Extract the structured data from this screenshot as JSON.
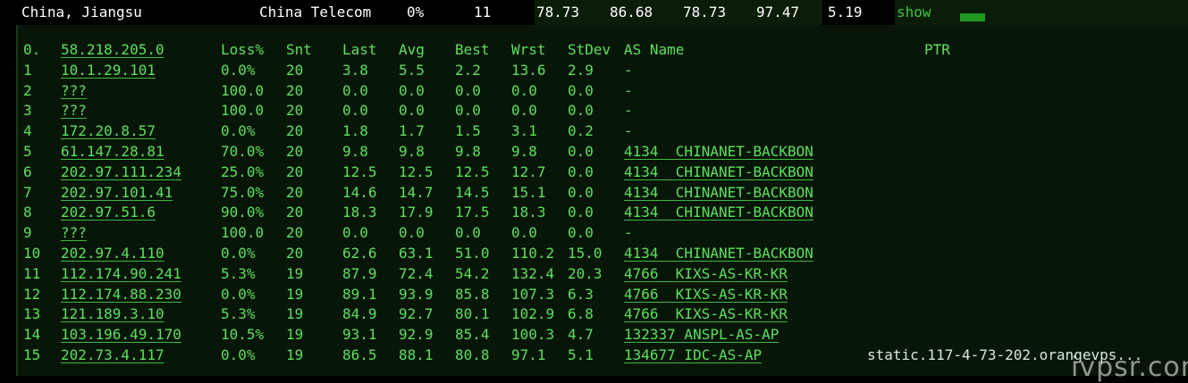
{
  "topbar": {
    "location": "China, Jiangsu",
    "isp": "China Telecom",
    "loss": "0%",
    "hops": "11",
    "v1": "78.73",
    "v2": "86.68",
    "v3": "78.73",
    "v4": "97.47",
    "v5": "5.19",
    "show_label": "show"
  },
  "table": {
    "header": {
      "num": "0.",
      "host": "58.218.205.0",
      "loss": "Loss%",
      "snt": "Snt",
      "last": "Last",
      "avg": "Avg",
      "best": "Best",
      "wrst": "Wrst",
      "stdev": "StDev",
      "asname": "AS Name",
      "ptr": "PTR"
    },
    "rows": [
      {
        "num": "1",
        "host": "10.1.29.101",
        "loss": "0.0%",
        "snt": "20",
        "last": "3.8",
        "avg": "5.5",
        "best": "2.2",
        "wrst": "13.6",
        "stdev": "2.9",
        "asname": "-",
        "ptr": ""
      },
      {
        "num": "2",
        "host": "???",
        "loss": "100.0",
        "snt": "20",
        "last": "0.0",
        "avg": "0.0",
        "best": "0.0",
        "wrst": "0.0",
        "stdev": "0.0",
        "asname": "-",
        "ptr": ""
      },
      {
        "num": "3",
        "host": "???",
        "loss": "100.0",
        "snt": "20",
        "last": "0.0",
        "avg": "0.0",
        "best": "0.0",
        "wrst": "0.0",
        "stdev": "0.0",
        "asname": "-",
        "ptr": ""
      },
      {
        "num": "4",
        "host": "172.20.8.57",
        "loss": "0.0%",
        "snt": "20",
        "last": "1.8",
        "avg": "1.7",
        "best": "1.5",
        "wrst": "3.1",
        "stdev": "0.2",
        "asname": "-",
        "ptr": ""
      },
      {
        "num": "5",
        "host": "61.147.28.81",
        "loss": "70.0%",
        "snt": "20",
        "last": "9.8",
        "avg": "9.8",
        "best": "9.8",
        "wrst": "9.8",
        "stdev": "0.0",
        "asname": "4134  CHINANET-BACKBON",
        "ptr": ""
      },
      {
        "num": "6",
        "host": "202.97.111.234",
        "loss": "25.0%",
        "snt": "20",
        "last": "12.5",
        "avg": "12.5",
        "best": "12.5",
        "wrst": "12.7",
        "stdev": "0.0",
        "asname": "4134  CHINANET-BACKBON",
        "ptr": ""
      },
      {
        "num": "7",
        "host": "202.97.101.41",
        "loss": "75.0%",
        "snt": "20",
        "last": "14.6",
        "avg": "14.7",
        "best": "14.5",
        "wrst": "15.1",
        "stdev": "0.0",
        "asname": "4134  CHINANET-BACKBON",
        "ptr": ""
      },
      {
        "num": "8",
        "host": "202.97.51.6",
        "loss": "90.0%",
        "snt": "20",
        "last": "18.3",
        "avg": "17.9",
        "best": "17.5",
        "wrst": "18.3",
        "stdev": "0.0",
        "asname": "4134  CHINANET-BACKBON",
        "ptr": ""
      },
      {
        "num": "9",
        "host": "???",
        "loss": "100.0",
        "snt": "20",
        "last": "0.0",
        "avg": "0.0",
        "best": "0.0",
        "wrst": "0.0",
        "stdev": "0.0",
        "asname": "-",
        "ptr": ""
      },
      {
        "num": "10",
        "host": "202.97.4.110",
        "loss": "0.0%",
        "snt": "20",
        "last": "62.6",
        "avg": "63.1",
        "best": "51.0",
        "wrst": "110.2",
        "stdev": "15.0",
        "asname": "4134  CHINANET-BACKBON",
        "ptr": ""
      },
      {
        "num": "11",
        "host": "112.174.90.241",
        "loss": "5.3%",
        "snt": "19",
        "last": "87.9",
        "avg": "72.4",
        "best": "54.2",
        "wrst": "132.4",
        "stdev": "20.3",
        "asname": "4766  KIXS-AS-KR-KR",
        "ptr": ""
      },
      {
        "num": "12",
        "host": "112.174.88.230",
        "loss": "0.0%",
        "snt": "19",
        "last": "89.1",
        "avg": "93.9",
        "best": "85.8",
        "wrst": "107.3",
        "stdev": "6.3",
        "asname": "4766  KIXS-AS-KR-KR",
        "ptr": ""
      },
      {
        "num": "13",
        "host": "121.189.3.10",
        "loss": "5.3%",
        "snt": "19",
        "last": "84.9",
        "avg": "92.7",
        "best": "80.1",
        "wrst": "102.9",
        "stdev": "6.8",
        "asname": "4766  KIXS-AS-KR-KR",
        "ptr": ""
      },
      {
        "num": "14",
        "host": "103.196.49.170",
        "loss": "10.5%",
        "snt": "19",
        "last": "93.1",
        "avg": "92.9",
        "best": "85.4",
        "wrst": "100.3",
        "stdev": "4.7",
        "asname": "132337 ANSPL-AS-AP",
        "ptr": ""
      },
      {
        "num": "15",
        "host": "202.73.4.117",
        "loss": "0.0%",
        "snt": "19",
        "last": "86.5",
        "avg": "88.1",
        "best": "80.8",
        "wrst": "97.1",
        "stdev": "5.1",
        "asname": "134677 IDC-AS-AP",
        "ptr": "static.117-4-73-202.orangevps..."
      }
    ]
  },
  "watermark": "ivpsr.com"
}
